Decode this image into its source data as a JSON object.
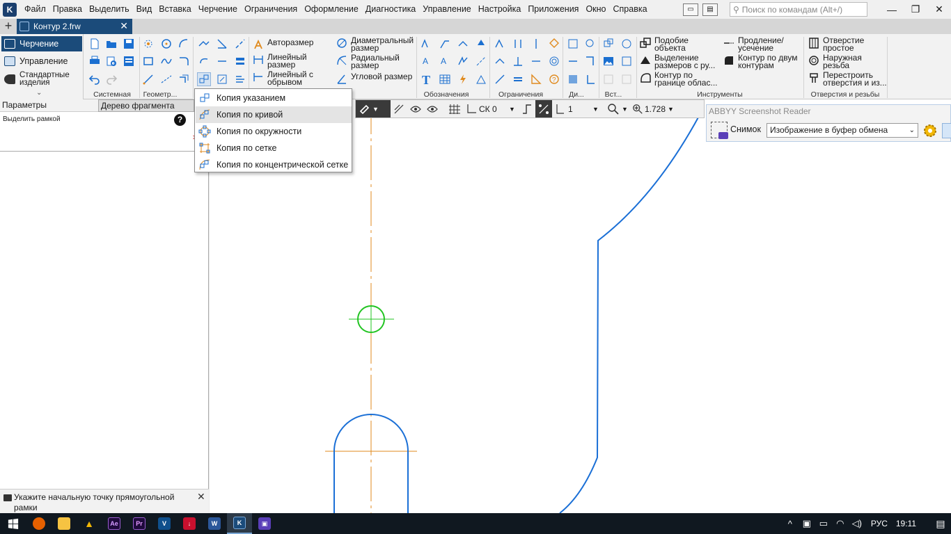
{
  "menubar": {
    "items": [
      "Файл",
      "Правка",
      "Выделить",
      "Вид",
      "Вставка",
      "Черчение",
      "Ограничения",
      "Оформление",
      "Диагностика",
      "Управление",
      "Настройка",
      "Приложения",
      "Окно",
      "Справка"
    ],
    "search_placeholder": "Поиск по командам (Alt+/)"
  },
  "tabs": {
    "document": "Контур 2.frw"
  },
  "ribbon": {
    "modes": {
      "drawing": "Черчение",
      "manage": "Управление",
      "standard": "Стандартные изделия"
    },
    "groups": {
      "system": "Системная",
      "geometry": "Геометр...",
      "annotations": "Обозначения",
      "constraints": "Ограничения",
      "dimensions": "Ди...",
      "insert": "Вст...",
      "tools": "Инструменты",
      "holes": "Отверстия и резьбы"
    },
    "buttons": {
      "autosize": "Авторазмер",
      "linear": "Линейный размер",
      "linear_break": "Линейный с обрывом",
      "diameter": "Диаметральный размер",
      "radial": "Радиальный размер",
      "angular": "Угловой размер",
      "similarity": "Подобие объекта",
      "select_dims": "Выделение размеров с ру...",
      "contour_boundary": "Контур по границе облас...",
      "extend_trim": "Продление/ усечение",
      "contour_two": "Контур по двум контурам",
      "hole_simple": "Отверстие простое",
      "outer_thread": "Наружная резьба",
      "rebuild_hole": "Перестроить отверстия и из..."
    }
  },
  "left_panel": {
    "tab_params": "Параметры",
    "tab_tree": "Дерево фрагмента",
    "select_frame": "Выделить рамкой",
    "hint": "Укажите начальную точку прямоугольной рамки"
  },
  "dropdown": {
    "items": [
      "Копия указанием",
      "Копия по кривой",
      "Копия по окружности",
      "Копия по сетке",
      "Копия по концентрической сетке"
    ],
    "hover_index": 1
  },
  "canvas_toolbar": {
    "cs": "СК 0",
    "layer": "1",
    "zoom": "1.728"
  },
  "abbyy": {
    "title": "ABBYY Screenshot Reader",
    "snapshot_label": "Снимок",
    "target_value": "Изображение в буфер обмена"
  },
  "taskbar": {
    "lang": "РУС",
    "time": "19:11"
  },
  "colors": {
    "accent": "#1b4b7a",
    "contour": "#1a6fd6",
    "axis": "#e08a1e",
    "point": "#22c422",
    "taskbar": "#101820"
  }
}
